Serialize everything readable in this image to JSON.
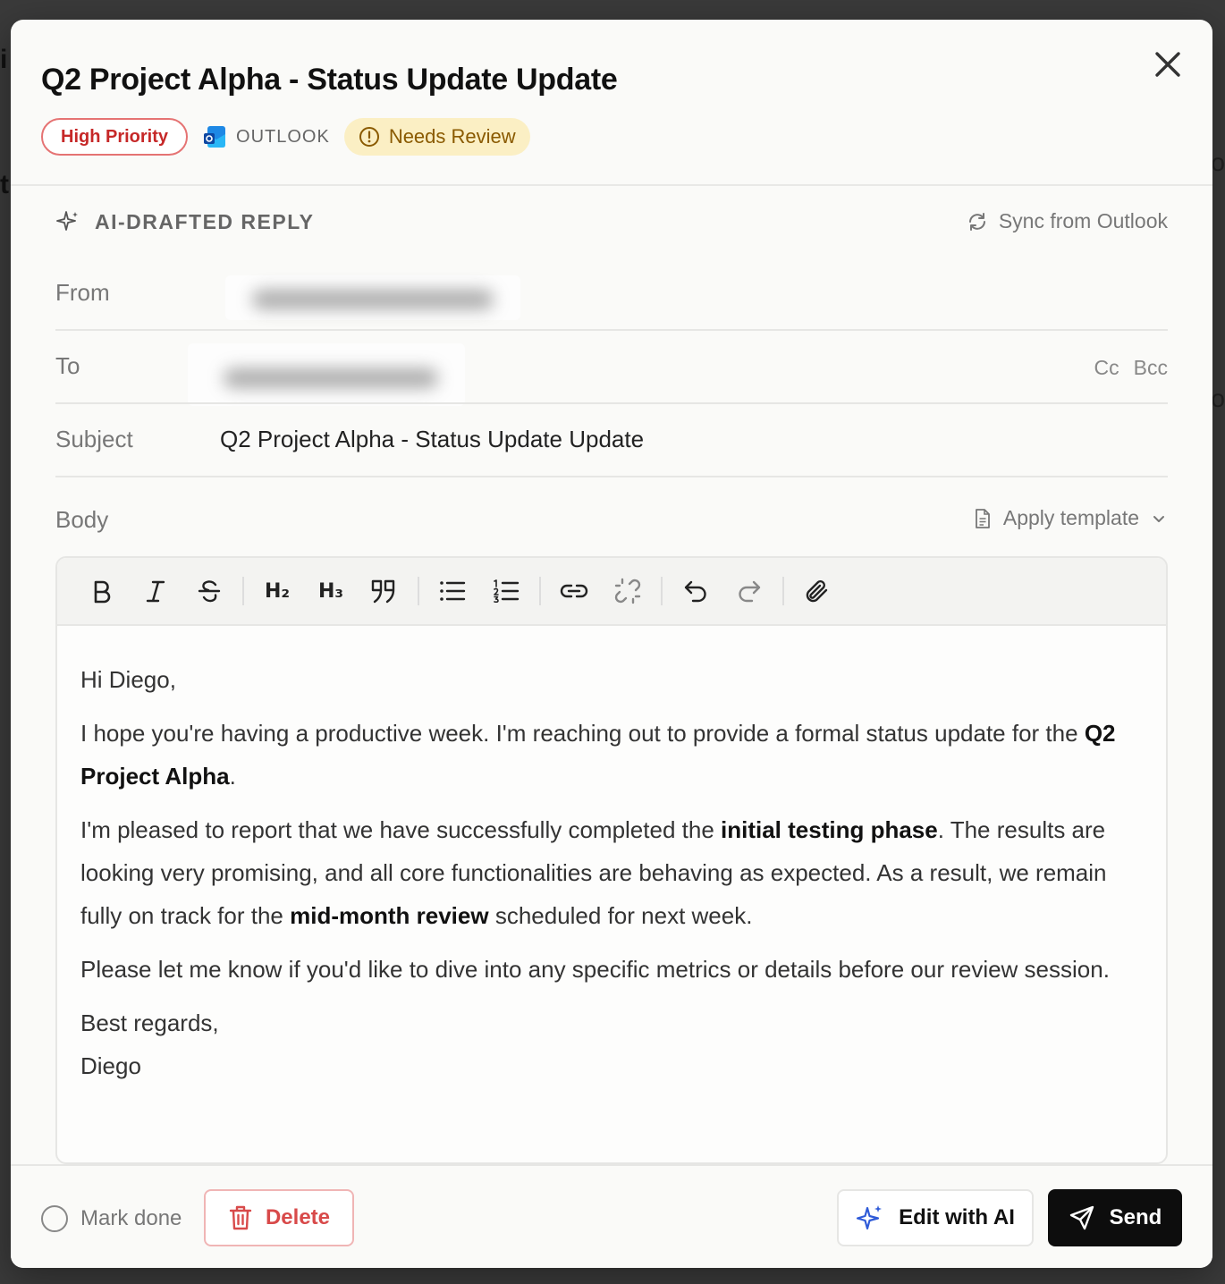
{
  "email": {
    "title": "Q2 Project Alpha - Status Update Update",
    "badges": {
      "priority": "High Priority",
      "source": "OUTLOOK",
      "status": "Needs Review"
    },
    "section_label": "AI-DRAFTED REPLY",
    "sync_label": "Sync from Outlook",
    "fields": {
      "from_label": "From",
      "to_label": "To",
      "cc_label": "Cc",
      "bcc_label": "Bcc",
      "subject_label": "Subject",
      "subject_value": "Q2 Project Alpha - Status Update Update"
    },
    "body": {
      "label": "Body",
      "apply_template": "Apply template",
      "greeting": "Hi Diego,",
      "p1_a": "I hope you're having a productive week. I'm reaching out to provide a formal status update for the ",
      "p1_bold": "Q2 Project Alpha",
      "p1_b": ".",
      "p2_a": "I'm pleased to report that we have successfully completed the ",
      "p2_bold1": "initial testing phase",
      "p2_b": ". The results are looking very promising, and all core functionalities are behaving as expected. As a result, we remain fully on track for the ",
      "p2_bold2": "mid-month review",
      "p2_c": " scheduled for next week.",
      "p3": "Please let me know if you'd like to dive into any specific metrics or details before our review session.",
      "closing": "Best regards,",
      "signature": "Diego"
    },
    "toolbar": {
      "h2": "H₂",
      "h3": "H₃"
    },
    "footer": {
      "mark_done": "Mark done",
      "delete": "Delete",
      "edit_ai": "Edit with AI",
      "send": "Send"
    }
  },
  "colors": {
    "priority": "#c62828",
    "review_bg": "#fbefc4",
    "review_text": "#8a5a00",
    "delete": "#d84a4a",
    "ai_accent": "#2f5bd8",
    "send_bg": "#0d0d0d"
  },
  "icons": [
    "close-icon",
    "outlook-icon",
    "alert-circle-icon",
    "sparkle-icon",
    "refresh-icon",
    "document-icon",
    "chevron-down-icon",
    "bold-icon",
    "italic-icon",
    "strikethrough-icon",
    "quote-icon",
    "bullet-list-icon",
    "numbered-list-icon",
    "link-icon",
    "unlink-icon",
    "undo-icon",
    "redo-icon",
    "paperclip-icon",
    "trash-icon",
    "send-icon"
  ]
}
